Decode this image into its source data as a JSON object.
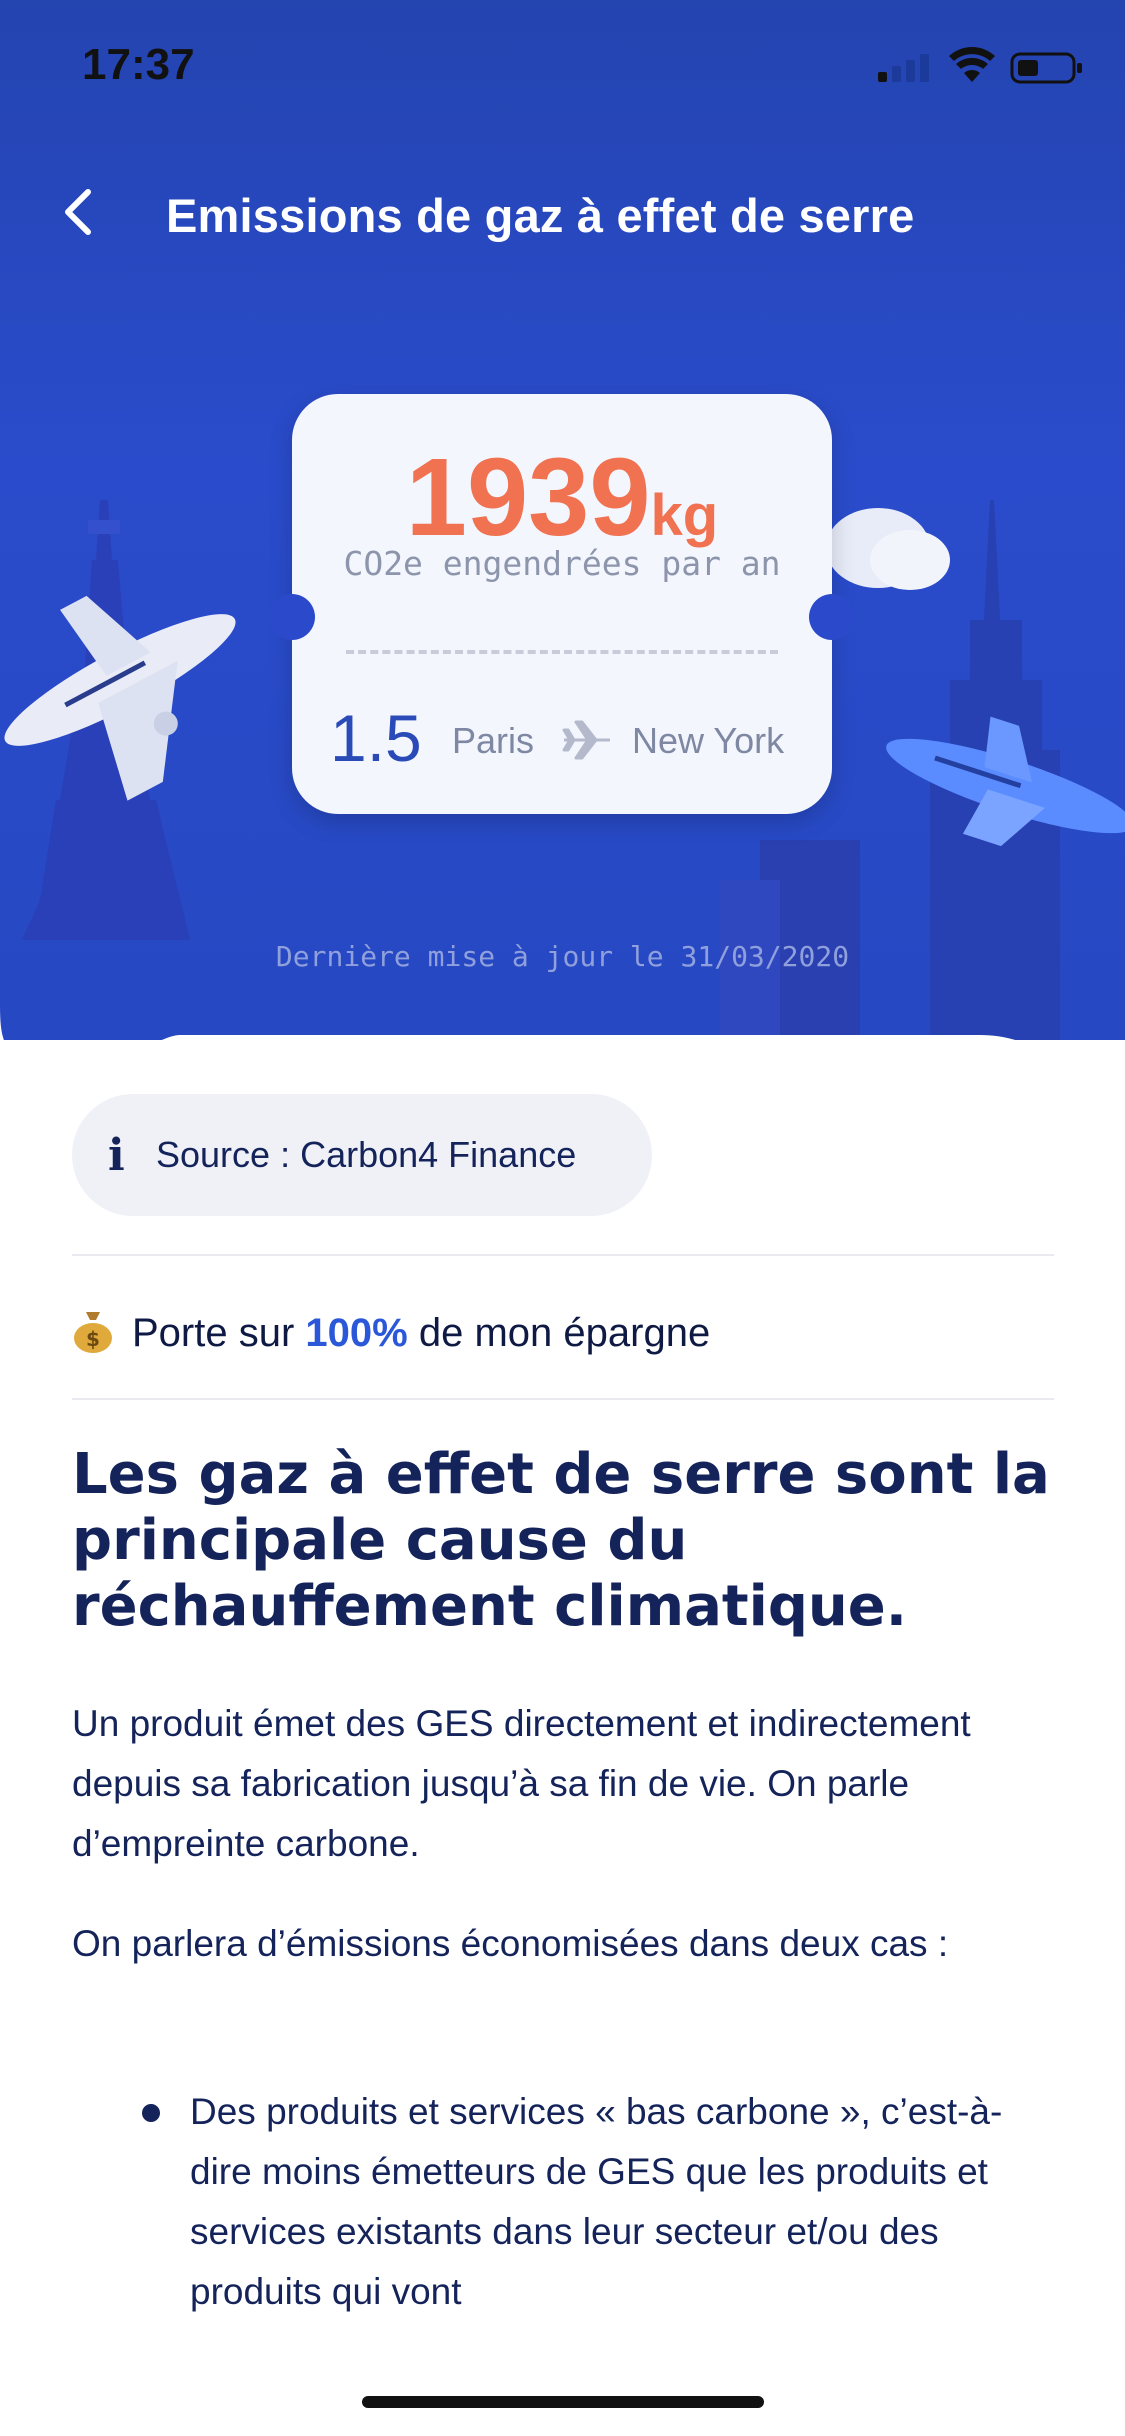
{
  "status_bar": {
    "time": "17:37"
  },
  "header": {
    "title": "Emissions de gaz à effet de serre"
  },
  "ticket": {
    "amount": "1939",
    "unit": "kg",
    "subtitle": "CO2e engendrées par an",
    "trips": "1.5",
    "from": "Paris",
    "to": "New York"
  },
  "last_update": "Dernière mise à jour le 31/03/2020",
  "source": {
    "label": "Source : Carbon4 Finance"
  },
  "savings": {
    "prefix": "Porte sur",
    "percent": "100%",
    "suffix": "de mon épargne"
  },
  "article": {
    "heading": "Les gaz à effet de serre sont la principale cause du réchauffement climatique.",
    "paragraph1": "Un produit émet des GES directement et indirectement depuis sa fabrication jusqu’à sa fin de vie. On parle d’empreinte carbone.",
    "paragraph2": "On parlera d’émissions économisées dans deux cas :",
    "bullet1": "Des produits et services « bas carbone », c’est-à-dire moins émetteurs de GES que les produits et services existants dans leur secteur et/ou des produits qui vont"
  },
  "colors": {
    "accent": "#2b58d8",
    "amount": "#f07250",
    "hero": "#2a4ccc",
    "text": "#14235a"
  }
}
